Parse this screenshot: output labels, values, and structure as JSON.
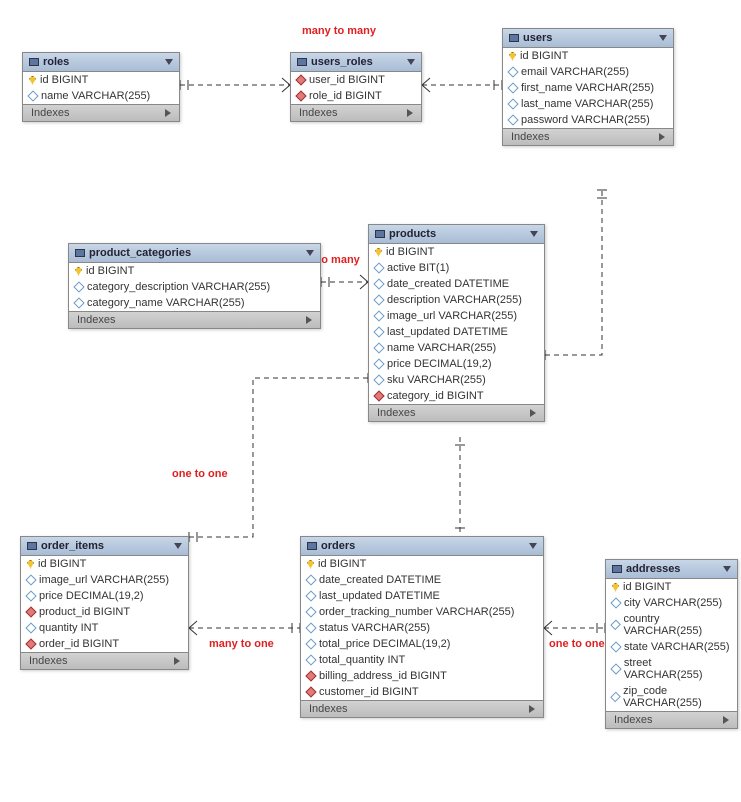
{
  "ui": {
    "indexes_label": "Indexes"
  },
  "labels": {
    "many_to_many": "many to many",
    "one_to_many": "one to many",
    "one_to_one_top": "one to one",
    "many_to_one": "many to one",
    "one_to_one_bottom": "one to one"
  },
  "tables": {
    "roles": {
      "name": "roles",
      "cols": [
        {
          "icon": "pk",
          "text": "id BIGINT"
        },
        {
          "icon": "attr",
          "text": "name VARCHAR(255)"
        }
      ]
    },
    "users_roles": {
      "name": "users_roles",
      "cols": [
        {
          "icon": "fk",
          "text": "user_id BIGINT"
        },
        {
          "icon": "fk",
          "text": "role_id BIGINT"
        }
      ]
    },
    "users": {
      "name": "users",
      "cols": [
        {
          "icon": "pk",
          "text": "id BIGINT"
        },
        {
          "icon": "attr",
          "text": "email VARCHAR(255)"
        },
        {
          "icon": "attr",
          "text": "first_name VARCHAR(255)"
        },
        {
          "icon": "attr",
          "text": "last_name VARCHAR(255)"
        },
        {
          "icon": "attr",
          "text": "password VARCHAR(255)"
        }
      ]
    },
    "product_categories": {
      "name": "product_categories",
      "cols": [
        {
          "icon": "pk",
          "text": "id BIGINT"
        },
        {
          "icon": "attr",
          "text": "category_description VARCHAR(255)"
        },
        {
          "icon": "attr",
          "text": "category_name VARCHAR(255)"
        }
      ]
    },
    "products": {
      "name": "products",
      "cols": [
        {
          "icon": "pk",
          "text": "id BIGINT"
        },
        {
          "icon": "attr",
          "text": "active BIT(1)"
        },
        {
          "icon": "attr",
          "text": "date_created DATETIME"
        },
        {
          "icon": "attr",
          "text": "description VARCHAR(255)"
        },
        {
          "icon": "attr",
          "text": "image_url VARCHAR(255)"
        },
        {
          "icon": "attr",
          "text": "last_updated DATETIME"
        },
        {
          "icon": "attr",
          "text": "name VARCHAR(255)"
        },
        {
          "icon": "attr",
          "text": "price DECIMAL(19,2)"
        },
        {
          "icon": "attr",
          "text": "sku VARCHAR(255)"
        },
        {
          "icon": "fk",
          "text": "category_id BIGINT"
        }
      ]
    },
    "order_items": {
      "name": "order_items",
      "cols": [
        {
          "icon": "pk",
          "text": "id BIGINT"
        },
        {
          "icon": "attr",
          "text": "image_url VARCHAR(255)"
        },
        {
          "icon": "attr",
          "text": "price DECIMAL(19,2)"
        },
        {
          "icon": "fk",
          "text": "product_id BIGINT"
        },
        {
          "icon": "attr",
          "text": "quantity INT"
        },
        {
          "icon": "fk",
          "text": "order_id BIGINT"
        }
      ]
    },
    "orders": {
      "name": "orders",
      "cols": [
        {
          "icon": "pk",
          "text": "id BIGINT"
        },
        {
          "icon": "attr",
          "text": "date_created DATETIME"
        },
        {
          "icon": "attr",
          "text": "last_updated DATETIME"
        },
        {
          "icon": "attr",
          "text": "order_tracking_number VARCHAR(255)"
        },
        {
          "icon": "attr",
          "text": "status VARCHAR(255)"
        },
        {
          "icon": "attr",
          "text": "total_price DECIMAL(19,2)"
        },
        {
          "icon": "attr",
          "text": "total_quantity INT"
        },
        {
          "icon": "fk",
          "text": "billing_address_id BIGINT"
        },
        {
          "icon": "fk",
          "text": "customer_id BIGINT"
        }
      ]
    },
    "addresses": {
      "name": "addresses",
      "cols": [
        {
          "icon": "pk",
          "text": "id BIGINT"
        },
        {
          "icon": "attr",
          "text": "city VARCHAR(255)"
        },
        {
          "icon": "attr",
          "text": "country VARCHAR(255)"
        },
        {
          "icon": "attr",
          "text": "state VARCHAR(255)"
        },
        {
          "icon": "attr",
          "text": "street VARCHAR(255)"
        },
        {
          "icon": "attr",
          "text": "zip_code VARCHAR(255)"
        }
      ]
    }
  }
}
